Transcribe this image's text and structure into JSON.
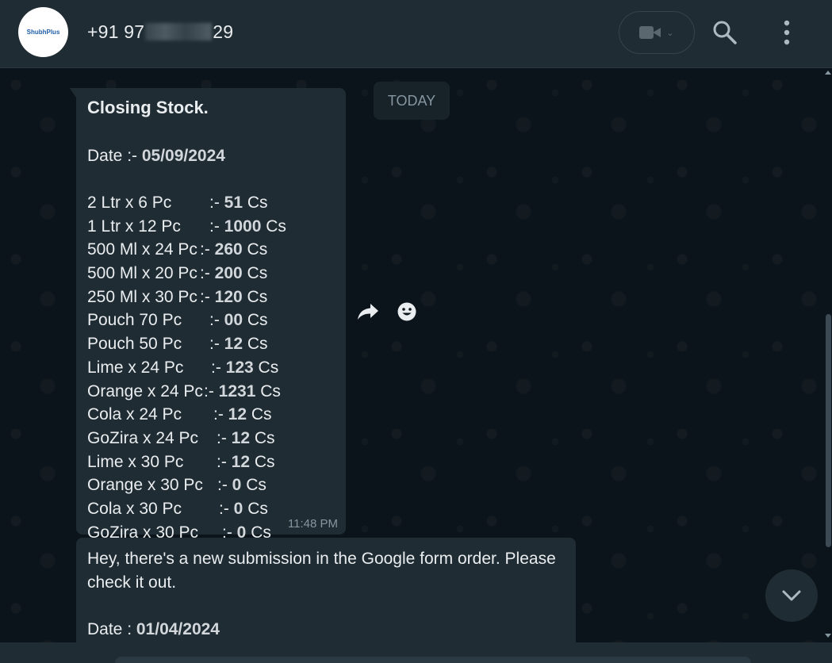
{
  "header": {
    "avatar_text": "ShubhPlus",
    "contact_prefix": "+91 97",
    "contact_suffix": "29"
  },
  "chat": {
    "date_chip": "TODAY",
    "message1": {
      "title": "Closing Stock.",
      "date_label": "Date :- ",
      "date_value": "05/09/2024",
      "items": [
        {
          "item": "2 Ltr x 6 Pc",
          "sep": ":- ",
          "qty": "51",
          "unit": " Cs"
        },
        {
          "item": "1 Ltr x 12 Pc",
          "sep": ":- ",
          "qty": "1000",
          "unit": " Cs"
        },
        {
          "item": "500 Ml x 24 Pc",
          "sep": ":- ",
          "qty": "260",
          "unit": " Cs"
        },
        {
          "item": "500 Ml x 20 Pc",
          "sep": ":- ",
          "qty": "200",
          "unit": " Cs"
        },
        {
          "item": "250 Ml x 30 Pc",
          "sep": ":- ",
          "qty": "120",
          "unit": " Cs"
        },
        {
          "item": "Pouch 70 Pc",
          "sep": ":- ",
          "qty": "00",
          "unit": " Cs"
        },
        {
          "item": "Pouch 50 Pc",
          "sep": ":- ",
          "qty": "12",
          "unit": " Cs"
        },
        {
          "item": "Lime x 24 Pc",
          "sep": ":- ",
          "qty": "123",
          "unit": " Cs"
        },
        {
          "item": "Orange x 24 Pc",
          "sep": ":- ",
          "qty": "1231",
          "unit": " Cs"
        },
        {
          "item": "Cola x 24 Pc",
          "sep": ":- ",
          "qty": "12",
          "unit": " Cs"
        },
        {
          "item": "GoZira x 24 Pc",
          "sep": ":- ",
          "qty": "12",
          "unit": " Cs"
        },
        {
          "item": "Lime x 30 Pc",
          "sep": ":- ",
          "qty": "12",
          "unit": " Cs"
        },
        {
          "item": "Orange x 30 Pc",
          "sep": ":- ",
          "qty": "0",
          "unit": " Cs"
        },
        {
          "item": "Cola x 30 Pc",
          "sep": ":- ",
          "qty": "0",
          "unit": " Cs"
        },
        {
          "item": "GoZira x 30 Pc",
          "sep": ":- ",
          "qty": "0",
          "unit": " Cs"
        }
      ],
      "time": "11:48 PM"
    },
    "message2": {
      "text": "Hey, there's a new submission in the Google form order. Please check it out.",
      "date_label": "Date : ",
      "date_value": "01/04/2024"
    }
  },
  "icons": {
    "video": "video-camera-icon",
    "search": "search-icon",
    "menu": "more-vertical-icon",
    "forward": "forward-icon",
    "emoji": "emoji-icon",
    "scroll_down": "chevron-down-icon"
  },
  "colors": {
    "background": "#0b141a",
    "header": "#202c33",
    "bubble": "#202c33",
    "secondary_text": "#8696a0"
  }
}
